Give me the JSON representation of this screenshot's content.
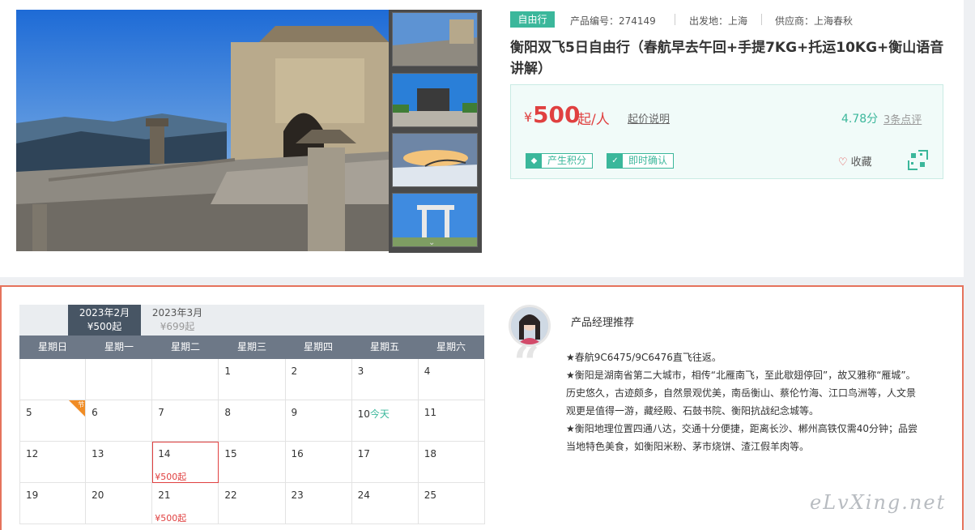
{
  "product": {
    "tag": "自由行",
    "code_label": "产品编号：274149",
    "depart_label": "出发地：上海",
    "supplier_label": "供应商：上海春秋",
    "title": "衡阳双飞5日自由行（春航早去午回+手提7KG+托运10KG+衡山语音讲解）"
  },
  "price": {
    "currency": "¥",
    "amount": "500",
    "unit": "起/人",
    "note": "起价说明",
    "score": "4.78分",
    "reviews": "3条点评",
    "badge_points": "产生积分",
    "badge_confirm": "即时确认",
    "favorite": "收藏",
    "color": "#e04040",
    "accent": "#3bb79b"
  },
  "calendar": {
    "months": [
      {
        "label": "2023年2月",
        "price": "¥500起"
      },
      {
        "label": "2023年3月",
        "price": "¥699起"
      }
    ],
    "weekdays": [
      "星期日",
      "星期一",
      "星期二",
      "星期三",
      "星期四",
      "星期五",
      "星期六"
    ],
    "rows": [
      [
        {
          "d": ""
        },
        {
          "d": ""
        },
        {
          "d": ""
        },
        {
          "d": "1"
        },
        {
          "d": "2"
        },
        {
          "d": "3"
        },
        {
          "d": "4"
        }
      ],
      [
        {
          "d": "5",
          "holiday": "节"
        },
        {
          "d": "6"
        },
        {
          "d": "7"
        },
        {
          "d": "8"
        },
        {
          "d": "9"
        },
        {
          "d": "10",
          "today": "今天"
        },
        {
          "d": "11"
        }
      ],
      [
        {
          "d": "12"
        },
        {
          "d": "13"
        },
        {
          "d": "14",
          "price": "¥500起",
          "selected": true
        },
        {
          "d": "15"
        },
        {
          "d": "16"
        },
        {
          "d": "17"
        },
        {
          "d": "18"
        }
      ],
      [
        {
          "d": "19"
        },
        {
          "d": "20"
        },
        {
          "d": "21",
          "price": "¥500起"
        },
        {
          "d": "22"
        },
        {
          "d": "23"
        },
        {
          "d": "24"
        },
        {
          "d": "25"
        }
      ]
    ]
  },
  "recommend": {
    "title": "产品经理推荐",
    "lines": [
      "★春航9C6475/9C6476直飞往返。",
      "★衡阳是湖南省第二大城市，相传“北雁南飞，至此歇翅停回”，故又雅称“雁城”。历史悠久，古迹颇多，自然景观优美，南岳衡山、蔡伦竹海、江口鸟洲等，人文景观更是值得一游，藏经殿、石鼓书院、衡阳抗战纪念城等。",
      "★衡阳地理位置四通八达，交通十分便捷，距离长沙、郴州高铁仅需40分钟；品尝当地特色美食，如衡阳米粉、茅市烧饼、渣江假羊肉等。"
    ]
  },
  "watermark": "eLvXing.net"
}
